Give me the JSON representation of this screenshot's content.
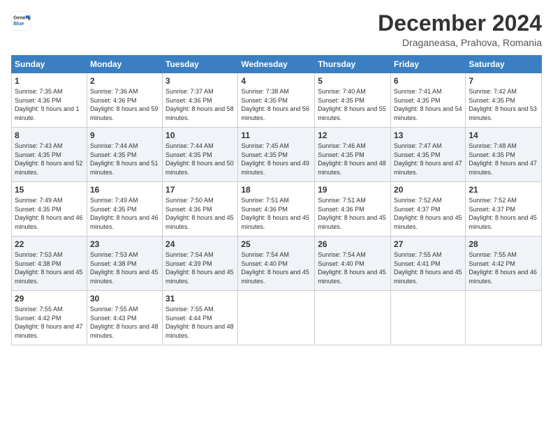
{
  "logo": {
    "line1": "General",
    "line2": "Blue"
  },
  "title": "December 2024",
  "subtitle": "Draganeasa, Prahova, Romania",
  "days_header": [
    "Sunday",
    "Monday",
    "Tuesday",
    "Wednesday",
    "Thursday",
    "Friday",
    "Saturday"
  ],
  "weeks": [
    [
      {
        "day": "1",
        "sunrise": "7:35 AM",
        "sunset": "4:36 PM",
        "daylight": "9 hours and 1 minute."
      },
      {
        "day": "2",
        "sunrise": "7:36 AM",
        "sunset": "4:36 PM",
        "daylight": "8 hours and 59 minutes."
      },
      {
        "day": "3",
        "sunrise": "7:37 AM",
        "sunset": "4:36 PM",
        "daylight": "8 hours and 58 minutes."
      },
      {
        "day": "4",
        "sunrise": "7:38 AM",
        "sunset": "4:35 PM",
        "daylight": "8 hours and 56 minutes."
      },
      {
        "day": "5",
        "sunrise": "7:40 AM",
        "sunset": "4:35 PM",
        "daylight": "8 hours and 55 minutes."
      },
      {
        "day": "6",
        "sunrise": "7:41 AM",
        "sunset": "4:35 PM",
        "daylight": "8 hours and 54 minutes."
      },
      {
        "day": "7",
        "sunrise": "7:42 AM",
        "sunset": "4:35 PM",
        "daylight": "8 hours and 53 minutes."
      }
    ],
    [
      {
        "day": "8",
        "sunrise": "7:43 AM",
        "sunset": "4:35 PM",
        "daylight": "8 hours and 52 minutes."
      },
      {
        "day": "9",
        "sunrise": "7:44 AM",
        "sunset": "4:35 PM",
        "daylight": "8 hours and 51 minutes."
      },
      {
        "day": "10",
        "sunrise": "7:44 AM",
        "sunset": "4:35 PM",
        "daylight": "8 hours and 50 minutes."
      },
      {
        "day": "11",
        "sunrise": "7:45 AM",
        "sunset": "4:35 PM",
        "daylight": "8 hours and 49 minutes."
      },
      {
        "day": "12",
        "sunrise": "7:46 AM",
        "sunset": "4:35 PM",
        "daylight": "8 hours and 48 minutes."
      },
      {
        "day": "13",
        "sunrise": "7:47 AM",
        "sunset": "4:35 PM",
        "daylight": "8 hours and 47 minutes."
      },
      {
        "day": "14",
        "sunrise": "7:48 AM",
        "sunset": "4:35 PM",
        "daylight": "8 hours and 47 minutes."
      }
    ],
    [
      {
        "day": "15",
        "sunrise": "7:49 AM",
        "sunset": "4:35 PM",
        "daylight": "8 hours and 46 minutes."
      },
      {
        "day": "16",
        "sunrise": "7:49 AM",
        "sunset": "4:35 PM",
        "daylight": "8 hours and 46 minutes."
      },
      {
        "day": "17",
        "sunrise": "7:50 AM",
        "sunset": "4:36 PM",
        "daylight": "8 hours and 45 minutes."
      },
      {
        "day": "18",
        "sunrise": "7:51 AM",
        "sunset": "4:36 PM",
        "daylight": "8 hours and 45 minutes."
      },
      {
        "day": "19",
        "sunrise": "7:51 AM",
        "sunset": "4:36 PM",
        "daylight": "8 hours and 45 minutes."
      },
      {
        "day": "20",
        "sunrise": "7:52 AM",
        "sunset": "4:37 PM",
        "daylight": "8 hours and 45 minutes."
      },
      {
        "day": "21",
        "sunrise": "7:52 AM",
        "sunset": "4:37 PM",
        "daylight": "8 hours and 45 minutes."
      }
    ],
    [
      {
        "day": "22",
        "sunrise": "7:53 AM",
        "sunset": "4:38 PM",
        "daylight": "8 hours and 45 minutes."
      },
      {
        "day": "23",
        "sunrise": "7:53 AM",
        "sunset": "4:38 PM",
        "daylight": "8 hours and 45 minutes."
      },
      {
        "day": "24",
        "sunrise": "7:54 AM",
        "sunset": "4:39 PM",
        "daylight": "8 hours and 45 minutes."
      },
      {
        "day": "25",
        "sunrise": "7:54 AM",
        "sunset": "4:40 PM",
        "daylight": "8 hours and 45 minutes."
      },
      {
        "day": "26",
        "sunrise": "7:54 AM",
        "sunset": "4:40 PM",
        "daylight": "8 hours and 45 minutes."
      },
      {
        "day": "27",
        "sunrise": "7:55 AM",
        "sunset": "4:41 PM",
        "daylight": "8 hours and 45 minutes."
      },
      {
        "day": "28",
        "sunrise": "7:55 AM",
        "sunset": "4:42 PM",
        "daylight": "8 hours and 46 minutes."
      }
    ],
    [
      {
        "day": "29",
        "sunrise": "7:55 AM",
        "sunset": "4:42 PM",
        "daylight": "8 hours and 47 minutes."
      },
      {
        "day": "30",
        "sunrise": "7:55 AM",
        "sunset": "4:43 PM",
        "daylight": "8 hours and 48 minutes."
      },
      {
        "day": "31",
        "sunrise": "7:55 AM",
        "sunset": "4:44 PM",
        "daylight": "8 hours and 48 minutes."
      },
      null,
      null,
      null,
      null
    ]
  ]
}
